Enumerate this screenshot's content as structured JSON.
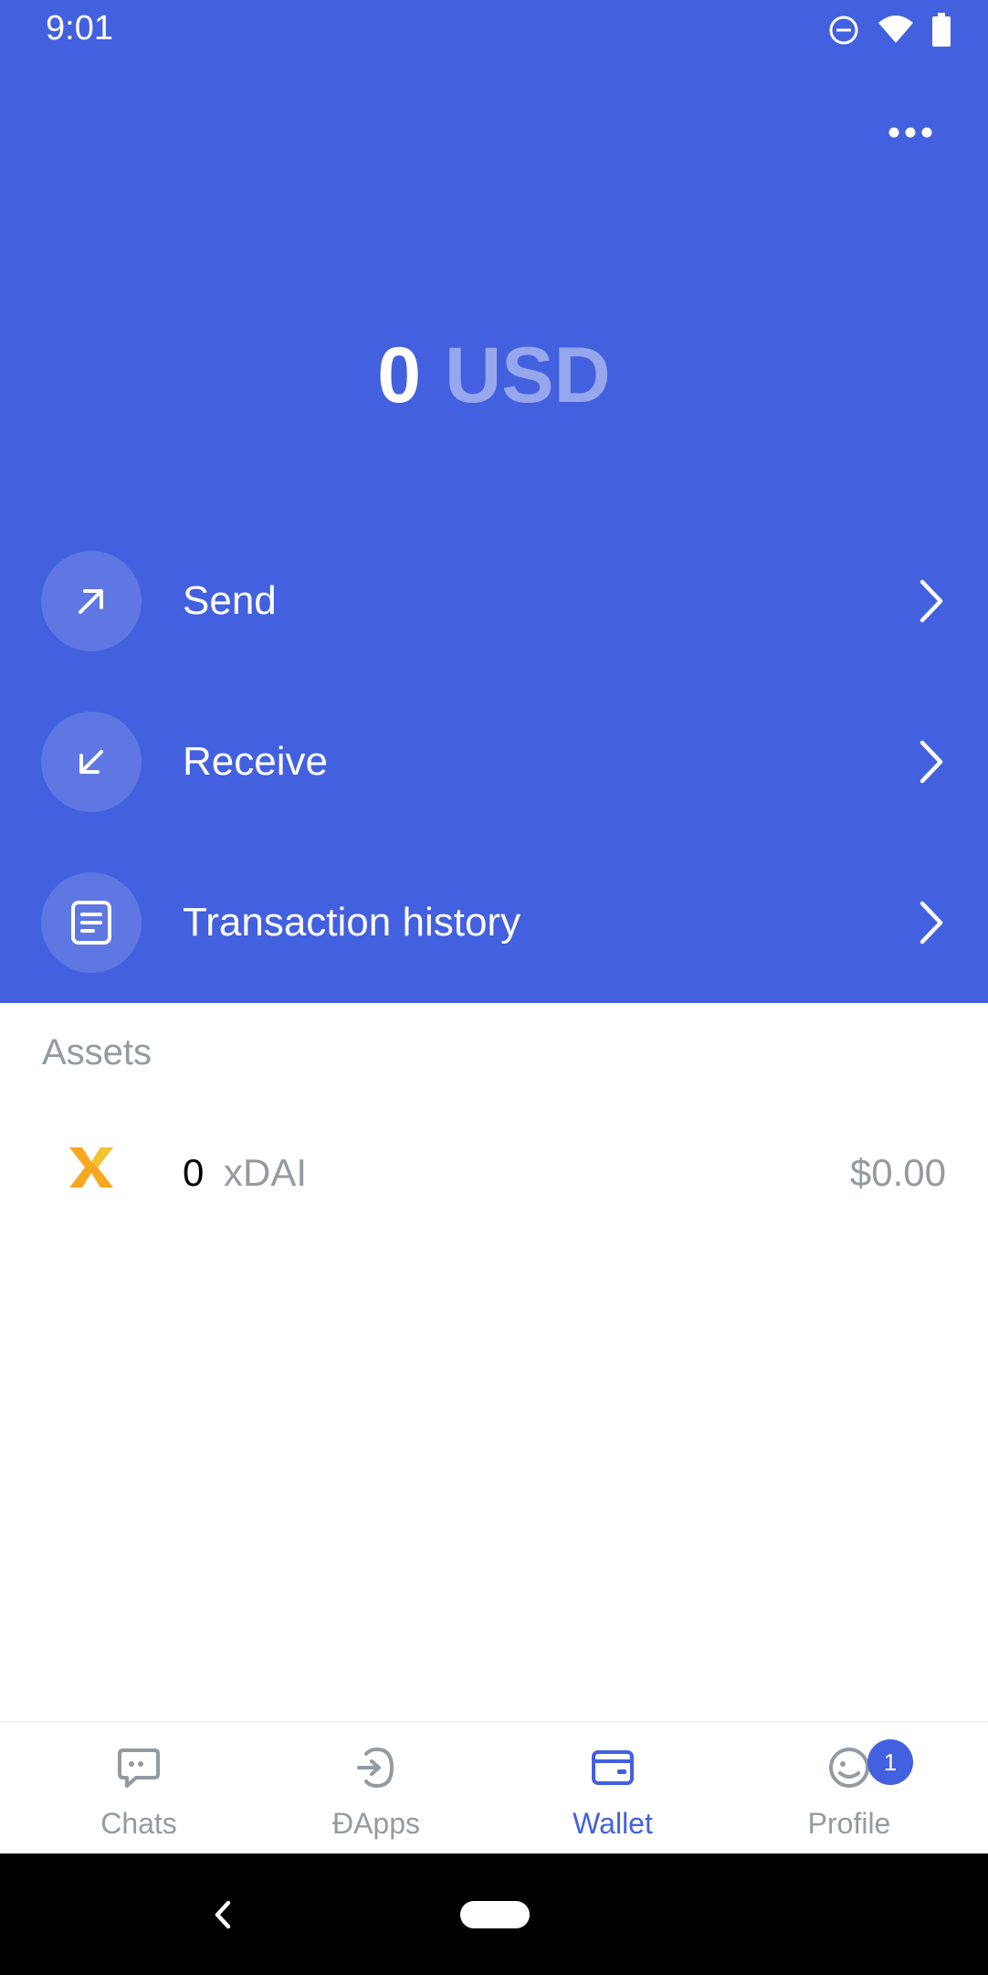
{
  "status_bar": {
    "time": "9:01"
  },
  "balance": {
    "amount": "0",
    "currency": "USD"
  },
  "actions": [
    {
      "label": "Send",
      "icon": "arrow-up-right-icon"
    },
    {
      "label": "Receive",
      "icon": "arrow-down-left-icon"
    },
    {
      "label": "Transaction history",
      "icon": "document-icon"
    }
  ],
  "assets": {
    "title": "Assets",
    "items": [
      {
        "amount": "0",
        "symbol": "xDAI",
        "fiat": "$0.00",
        "icon": "xdai-token-icon"
      }
    ]
  },
  "tabs": [
    {
      "label": "Chats",
      "icon": "chat-icon",
      "active": false
    },
    {
      "label": "ÐApps",
      "icon": "dapps-icon",
      "active": false
    },
    {
      "label": "Wallet",
      "icon": "wallet-icon",
      "active": true
    },
    {
      "label": "Profile",
      "icon": "profile-icon",
      "active": false,
      "badge": "1"
    }
  ],
  "colors": {
    "primary": "#4360df",
    "muted": "#939ba1",
    "accent_token": "#f7a821"
  }
}
